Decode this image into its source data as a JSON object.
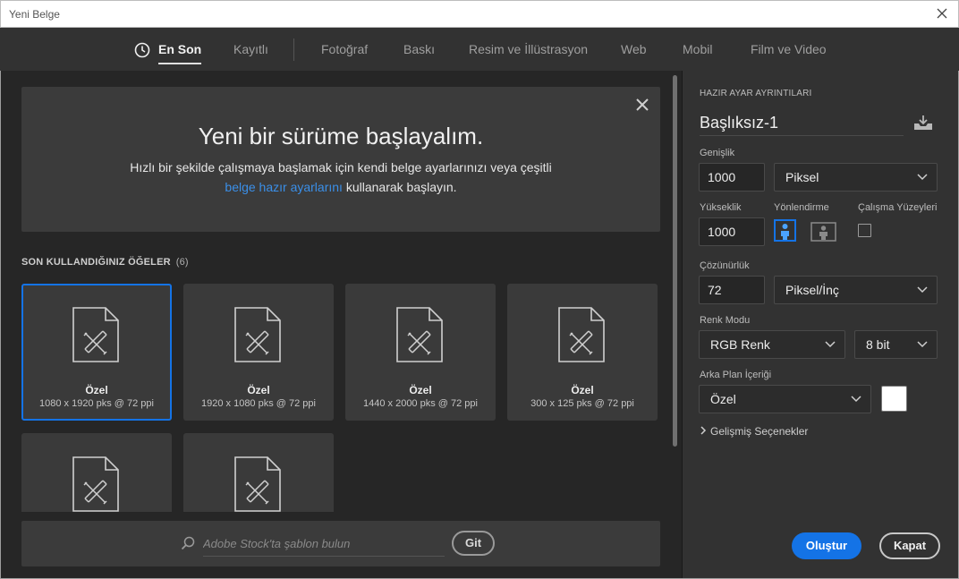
{
  "window": {
    "title": "Yeni Belge"
  },
  "tabs": [
    {
      "label": "En Son",
      "active": true
    },
    {
      "label": "Kayıtlı"
    },
    {
      "label": "Fotoğraf"
    },
    {
      "label": "Baskı"
    },
    {
      "label": "Resim ve İllüstrasyon"
    },
    {
      "label": "Web"
    },
    {
      "label": "Mobil"
    },
    {
      "label": "Film ve Video"
    }
  ],
  "welcome": {
    "heading": "Yeni bir sürüme başlayalım.",
    "line1": "Hızlı bir şekilde çalışmaya başlamak için kendi belge ayarlarınızı veya çeşitli",
    "link": "belge hazır ayarlarını",
    "line2_rest": " kullanarak başlayın."
  },
  "recent": {
    "title": "SON KULLANDIĞINIZ ÖĞELER",
    "count": "(6)",
    "items": [
      {
        "name": "Özel",
        "dims": "1080 x 1920 pks @ 72 ppi"
      },
      {
        "name": "Özel",
        "dims": "1920 x 1080 pks @ 72 ppi"
      },
      {
        "name": "Özel",
        "dims": "1440 x 2000 pks @ 72 ppi"
      },
      {
        "name": "Özel",
        "dims": "300 x 125 pks @ 72 ppi"
      },
      {
        "name": "",
        "dims": ""
      },
      {
        "name": "",
        "dims": ""
      }
    ]
  },
  "search": {
    "placeholder": "Adobe Stock'ta şablon bulun",
    "go_label": "Git"
  },
  "preset": {
    "header": "HAZIR AYAR AYRINTILARI",
    "name": "Başlıksız-1",
    "width_label": "Genişlik",
    "width_value": "1000",
    "width_unit": "Piksel",
    "height_label": "Yükseklik",
    "height_value": "1000",
    "orientation_label": "Yönlendirme",
    "artboards_label": "Çalışma Yüzeyleri",
    "resolution_label": "Çözünürlük",
    "resolution_value": "72",
    "resolution_unit": "Piksel/İnç",
    "color_mode_label": "Renk Modu",
    "color_mode_value": "RGB Renk",
    "bit_depth": "8 bit",
    "background_label": "Arka Plan İçeriği",
    "background_value": "Özel",
    "background_color": "#ffffff",
    "advanced_label": "Gelişmiş Seçenekler"
  },
  "actions": {
    "create_label": "Oluştur",
    "close_label": "Kapat"
  },
  "colors": {
    "accent": "#1473e6",
    "link": "#3b8fe8"
  }
}
